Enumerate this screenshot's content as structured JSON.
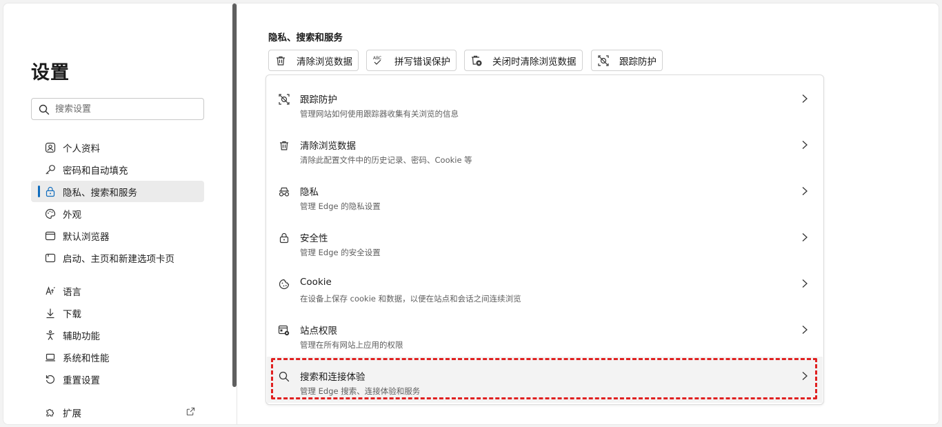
{
  "sidebar": {
    "title": "设置",
    "search_placeholder": "搜索设置",
    "items": [
      {
        "label": "个人资料",
        "icon": "profile-icon"
      },
      {
        "label": "密码和自动填充",
        "icon": "key-icon"
      },
      {
        "label": "隐私、搜索和服务",
        "icon": "lock-icon",
        "active": true
      },
      {
        "label": "外观",
        "icon": "palette-icon"
      },
      {
        "label": "默认浏览器",
        "icon": "browser-icon"
      },
      {
        "label": "启动、主页和新建选项卡页",
        "icon": "home-tab-icon"
      },
      {
        "label": "语言",
        "icon": "language-icon"
      },
      {
        "label": "下载",
        "icon": "download-icon"
      },
      {
        "label": "辅助功能",
        "icon": "accessibility-icon"
      },
      {
        "label": "系统和性能",
        "icon": "laptop-icon"
      },
      {
        "label": "重置设置",
        "icon": "reset-icon"
      },
      {
        "label": "扩展",
        "icon": "extension-icon"
      }
    ]
  },
  "main": {
    "heading": "隐私、搜索和服务",
    "chips": [
      {
        "label": "清除浏览数据",
        "icon": "trash-icon"
      },
      {
        "label": "拼写错误保护",
        "icon": "spellcheck-icon",
        "icon_text": "ABC"
      },
      {
        "label": "关闭时清除浏览数据",
        "icon": "trash-clock-icon"
      },
      {
        "label": "跟踪防护",
        "icon": "tracking-icon"
      }
    ],
    "rows": [
      {
        "title": "跟踪防护",
        "subtitle": "管理网站如何使用跟踪器收集有关浏览的信息",
        "icon": "tracking-icon"
      },
      {
        "title": "清除浏览数据",
        "subtitle": "清除此配置文件中的历史记录、密码、Cookie 等",
        "icon": "trash-icon"
      },
      {
        "title": "隐私",
        "subtitle": "管理 Edge 的隐私设置",
        "icon": "incognito-icon"
      },
      {
        "title": "安全性",
        "subtitle": "管理 Edge 的安全设置",
        "icon": "lock-icon"
      },
      {
        "title": "Cookie",
        "subtitle": "在设备上保存 cookie 和数据，以便在站点和会话之间连续浏览",
        "icon": "cookie-icon"
      },
      {
        "title": "站点权限",
        "subtitle": "管理在所有网站上应用的权限",
        "icon": "site-permissions-icon"
      },
      {
        "title": "搜索和连接体验",
        "subtitle": "管理 Edge 搜索、连接体验和服务",
        "icon": "search-icon",
        "highlighted": true
      }
    ]
  },
  "colors": {
    "accent": "#0f6cbd",
    "highlight_border": "#e02020"
  }
}
